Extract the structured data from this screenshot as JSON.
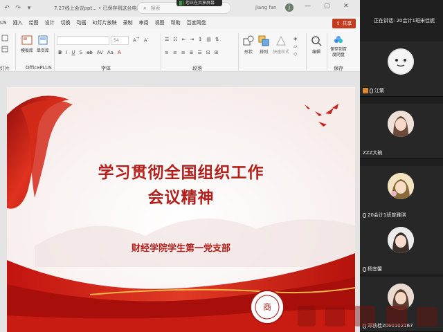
{
  "window": {
    "doc_title": "7.27线上会议ppt... • 已保存到这台电脑",
    "search_placeholder": "搜索",
    "user_name": "jiang fan",
    "user_initial": "J",
    "sharing_badge": "您正在共享屏幕"
  },
  "menu": {
    "items": [
      "US",
      "插入",
      "绘图",
      "设计",
      "切换",
      "动画",
      "幻灯片放映",
      "录制",
      "审阅",
      "视图",
      "帮助",
      "百度网盘"
    ],
    "share_label": "共享"
  },
  "ribbon": {
    "slide_label": "灯片",
    "officeplus_label": "OfficePLUS",
    "template_lib": "模板库",
    "single_page": "单页库",
    "font_label": "字体",
    "font_size": "54",
    "paragraph_label": "段落",
    "shape": "形状",
    "arrange": "排列",
    "quick_style": "快速样式",
    "edit": "编辑",
    "save_baidu": "保存到百度网盘",
    "save_label": "保存"
  },
  "slide": {
    "title_line1": "学习贯彻全国组织工作",
    "title_line2": "会议精神",
    "subtitle": "财经学院学生第一党支部"
  },
  "meeting": {
    "speaking": "正在讲话:  20会计1班宋佳妮",
    "participants": [
      {
        "name": "江繁"
      },
      {
        "name": "ZZZ大碗"
      },
      {
        "name": "20会计1班曾雅琪"
      },
      {
        "name": "杨宜馨"
      },
      {
        "name": "邓秋桂2060102167"
      }
    ]
  },
  "colors": {
    "accent_red": "#b3201c",
    "share_button": "#c43b1d",
    "panel_bg": "#1f1f1f"
  }
}
